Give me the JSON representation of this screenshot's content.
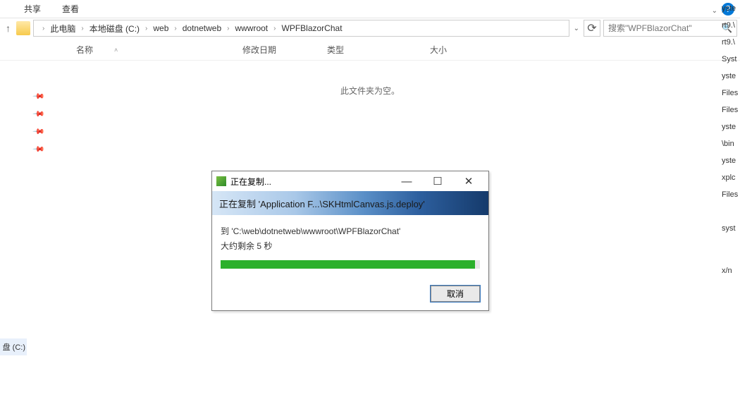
{
  "menu": {
    "share": "共享",
    "view": "查看"
  },
  "breadcrumb": [
    "此电脑",
    "本地磁盘 (C:)",
    "web",
    "dotnetweb",
    "wwwroot",
    "WPFBlazorChat"
  ],
  "search": {
    "placeholder": "搜索\"WPFBlazorChat\""
  },
  "columns": {
    "name": "名称",
    "date": "修改日期",
    "type": "类型",
    "size": "大小"
  },
  "emptyFolder": "此文件夹为空。",
  "leftFragment": "盘 (C:)",
  "rightFragments": [
    "yste",
    "rt9.\\",
    "rt9.\\",
    "Syst",
    "yste",
    "Files",
    "Files",
    "yste",
    "\\bin",
    "yste",
    "xplc",
    "Files",
    "",
    "",
    "syst",
    "",
    "",
    "",
    "x/n"
  ],
  "dialog": {
    "title": "正在复制...",
    "banner": "正在复制 'Application F...\\SKHtmlCanvas.js.deploy'",
    "dest": "到 'C:\\web\\dotnetweb\\wwwroot\\WPFBlazorChat'",
    "remaining": "大约剩余 5 秒",
    "cancel": "取消",
    "progressPercent": 98
  }
}
